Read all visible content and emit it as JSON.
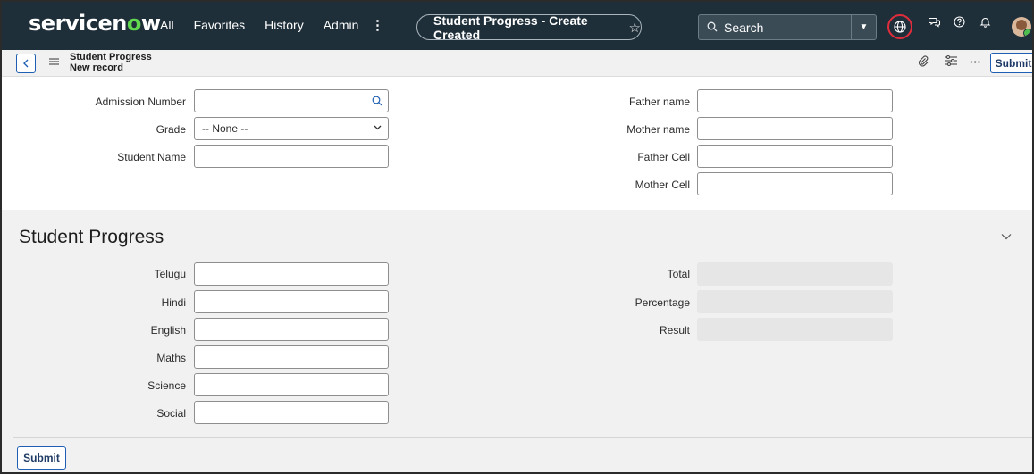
{
  "nav": {
    "logo_main": "servicen",
    "logo_o": "o",
    "logo_tail": "w",
    "links": [
      "All",
      "Favorites",
      "History",
      "Admin"
    ],
    "more": "⋮",
    "context_title": "Student Progress - Create Created",
    "star": "☆",
    "search_label": "Search",
    "icons": [
      "globe-icon",
      "chat-icon",
      "help-icon",
      "bell-icon"
    ]
  },
  "form_header": {
    "title": "Student Progress",
    "subtitle": "New record",
    "submit_label": "Submit"
  },
  "fields_left": [
    {
      "label": "Admission Number",
      "value": ""
    },
    {
      "label": "Grade",
      "value": "-- None --"
    },
    {
      "label": "Student Name",
      "value": ""
    }
  ],
  "fields_right": [
    {
      "label": "Father name",
      "value": ""
    },
    {
      "label": "Mother name",
      "value": ""
    },
    {
      "label": "Father Cell",
      "value": ""
    },
    {
      "label": "Mother Cell",
      "value": ""
    }
  ],
  "section": {
    "title": "Student Progress",
    "subjects": [
      {
        "label": "Telugu",
        "value": ""
      },
      {
        "label": "Hindi",
        "value": ""
      },
      {
        "label": "English",
        "value": ""
      },
      {
        "label": "Maths",
        "value": ""
      },
      {
        "label": "Science",
        "value": ""
      },
      {
        "label": "Social",
        "value": ""
      }
    ],
    "results": [
      {
        "label": "Total",
        "value": ""
      },
      {
        "label": "Percentage",
        "value": ""
      },
      {
        "label": "Result",
        "value": ""
      }
    ]
  },
  "footer": {
    "submit_label": "Submit"
  },
  "colors": {
    "nav_bg": "#1f2f3a",
    "accent": "#1e5fb3",
    "logo_green": "#62d84e",
    "focus_ring": "#e02d3c"
  }
}
